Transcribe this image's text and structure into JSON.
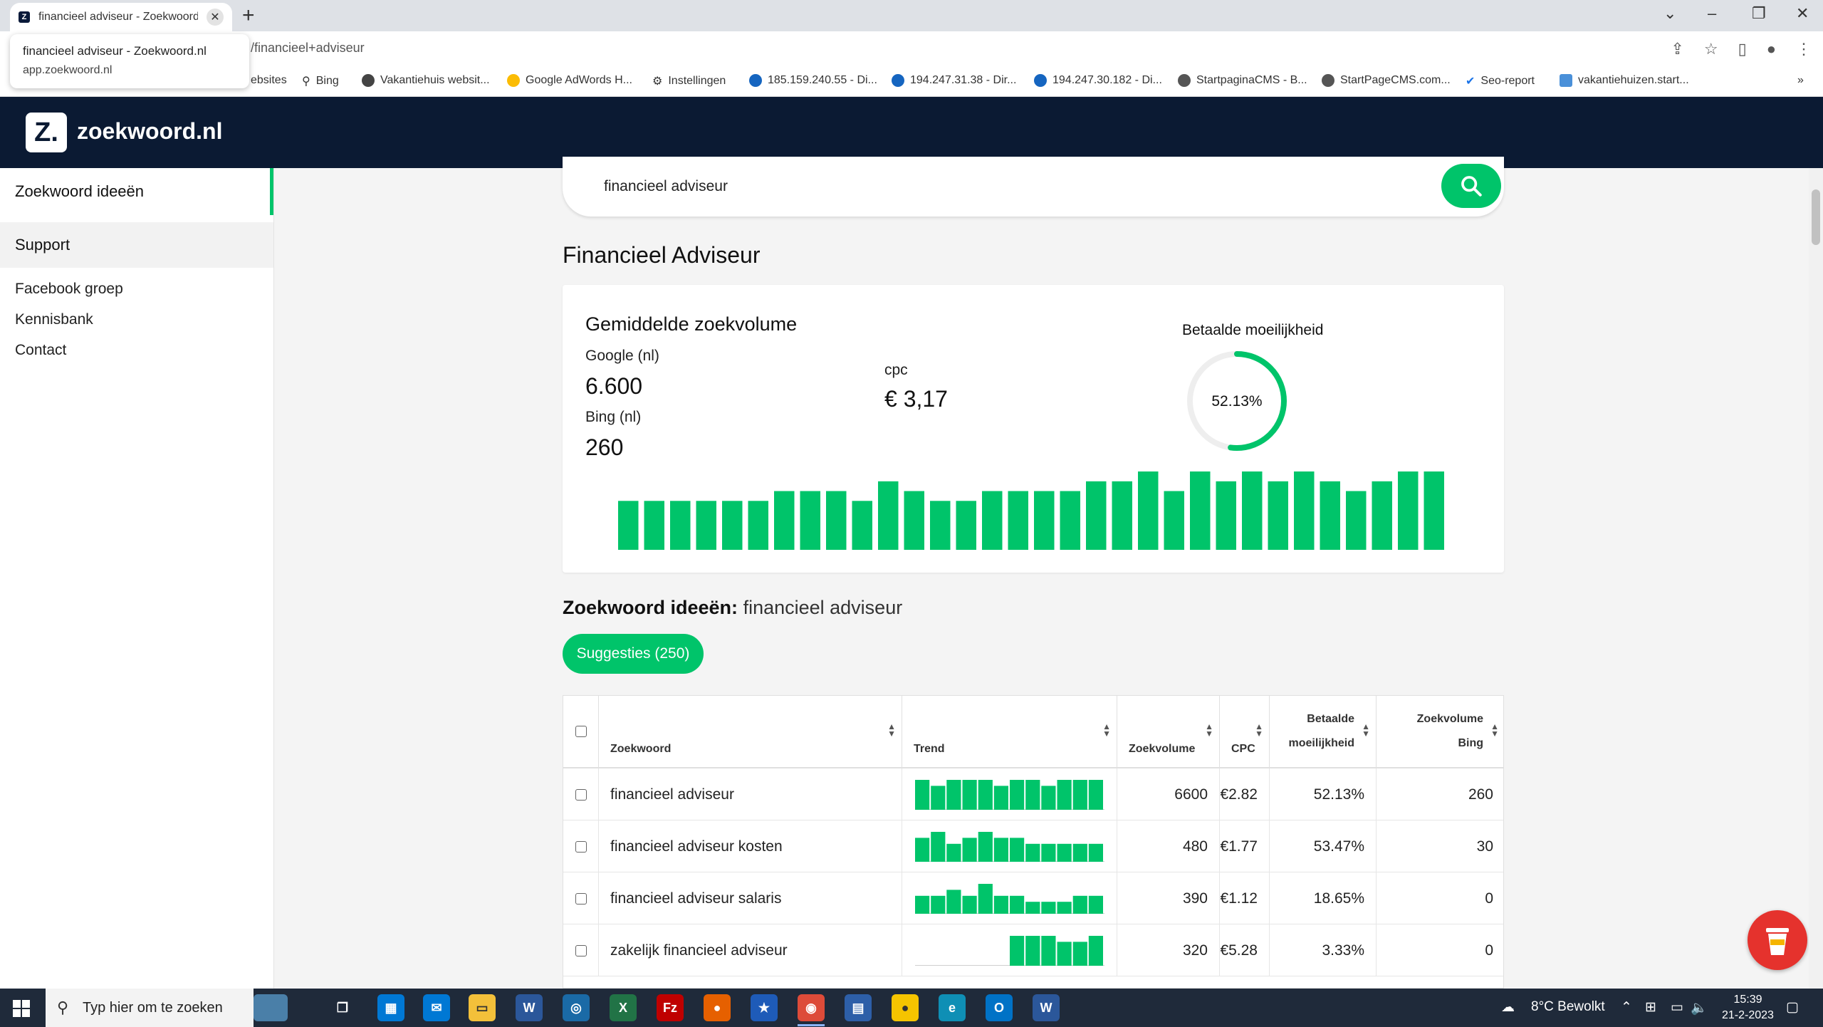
{
  "browser": {
    "tab_title": "financieel adviseur - Zoekwoord",
    "tab_favicon": "Z",
    "tooltip_title": "financieel adviseur - Zoekwoord.nl",
    "tooltip_domain": "app.zoekwoord.nl",
    "url": "/financieel+adviseur",
    "bookmarks": [
      {
        "label": "ebsites"
      },
      {
        "label": "Bing"
      },
      {
        "label": "Vakantiehuis websit..."
      },
      {
        "label": "Google AdWords H..."
      },
      {
        "label": "Instellingen"
      },
      {
        "label": "185.159.240.55 - Di..."
      },
      {
        "label": "194.247.31.38 - Dir..."
      },
      {
        "label": "194.247.30.182 - Di..."
      },
      {
        "label": "StartpaginaCMS - B..."
      },
      {
        "label": "StartPageCMS.com..."
      },
      {
        "label": "Seo-report"
      },
      {
        "label": "vakantiehuizen.start..."
      }
    ],
    "bookmarks_more": "»"
  },
  "app": {
    "logo_letter": "Z.",
    "logo_text": "zoekwoord.nl"
  },
  "sidebar": {
    "active_item": "Zoekwoord ideeën",
    "section": "Support",
    "links": [
      "Facebook groep",
      "Kennisbank",
      "Contact"
    ]
  },
  "search": {
    "value": "financieel adviseur"
  },
  "main": {
    "page_title": "Financieel Adviseur",
    "card": {
      "title": "Gemiddelde zoekvolume",
      "google_label": "Google (nl)",
      "google_value": "6.600",
      "bing_label": "Bing (nl)",
      "bing_value": "260",
      "cpc_label": "cpc",
      "cpc_value": "€ 3,17",
      "difficulty_title": "Betaalde moeilijkheid",
      "difficulty_value": "52.13%",
      "difficulty_fraction": 0.5213,
      "accent_color": "#00c46a"
    },
    "ideas_heading": "Zoekwoord ideeën:",
    "ideas_keyword": "financieel adviseur",
    "suggestions_button": "Suggesties (250)"
  },
  "chart_data": {
    "type": "bar",
    "values": [
      5,
      5,
      5,
      5,
      5,
      5,
      6,
      6,
      6,
      5,
      7,
      6,
      5,
      5,
      6,
      6,
      6,
      6,
      7,
      7,
      8,
      6,
      8,
      7,
      8,
      7,
      8,
      7,
      6,
      7,
      8,
      8
    ],
    "color": "#00c46a"
  },
  "table": {
    "columns": [
      "Zoekwoord",
      "Trend",
      "Zoekvolume",
      "CPC",
      "Betaalde moeilijkheid",
      "Zoekvolume Bing"
    ],
    "column_lines": {
      "difficulty": [
        "Betaalde",
        "moeilijkheid"
      ],
      "bing": [
        "Zoekvolume",
        "Bing"
      ]
    },
    "rows": [
      {
        "keyword": "financieel adviseur",
        "volume": "6600",
        "cpc": "€2.82",
        "difficulty": "52.13%",
        "bing": "260",
        "trend": [
          5,
          4,
          5,
          5,
          5,
          4,
          5,
          5,
          4,
          5,
          5,
          5
        ]
      },
      {
        "keyword": "financieel adviseur kosten",
        "volume": "480",
        "cpc": "€1.77",
        "difficulty": "53.47%",
        "bing": "30",
        "trend": [
          4,
          5,
          3,
          4,
          5,
          4,
          4,
          3,
          3,
          3,
          3,
          3
        ]
      },
      {
        "keyword": "financieel adviseur salaris",
        "volume": "390",
        "cpc": "€1.12",
        "difficulty": "18.65%",
        "bing": "0",
        "trend": [
          3,
          3,
          4,
          3,
          5,
          3,
          3,
          2,
          2,
          2,
          3,
          3
        ]
      },
      {
        "keyword": "zakelijk financieel adviseur",
        "volume": "320",
        "cpc": "€5.28",
        "difficulty": "3.33%",
        "bing": "0",
        "trend": [
          0,
          0,
          0,
          0,
          0,
          0,
          5,
          5,
          5,
          4,
          4,
          5
        ]
      }
    ]
  },
  "taskbar": {
    "search_placeholder": "Typ hier om te zoeken",
    "weather": "8°C  Bewolkt",
    "time": "15:39",
    "date": "21-2-2023"
  }
}
